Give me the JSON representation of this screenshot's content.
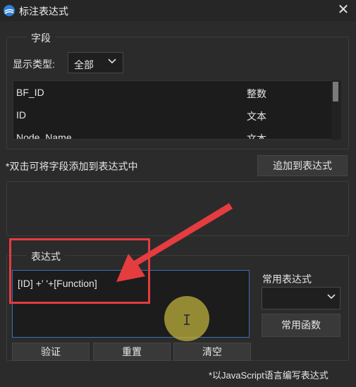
{
  "window": {
    "title": "标注表达式",
    "close_glyph": "✕"
  },
  "fields": {
    "legend": "字段",
    "type_label": "显示类型:",
    "type_value": "全部",
    "rows": [
      {
        "name": "BF_ID",
        "type": "整数"
      },
      {
        "name": "ID",
        "type": "文本"
      },
      {
        "name": "Node_Name",
        "type": "文本"
      }
    ]
  },
  "hint": "*双击可将字段添加到表达式中",
  "append_button": "追加到表达式",
  "expression": {
    "legend": "表达式",
    "value": "[ID] +' '+[Function]",
    "common_label": "常用表达式",
    "common_value": "",
    "function_button": "常用函数"
  },
  "buttons": {
    "verify": "验证",
    "reset": "重置",
    "clear": "清空"
  },
  "note": "*以JavaScript语言编写表达式",
  "annotation_colors": {
    "arrow": "#e43c3f",
    "cursor": "#bfae3c"
  }
}
